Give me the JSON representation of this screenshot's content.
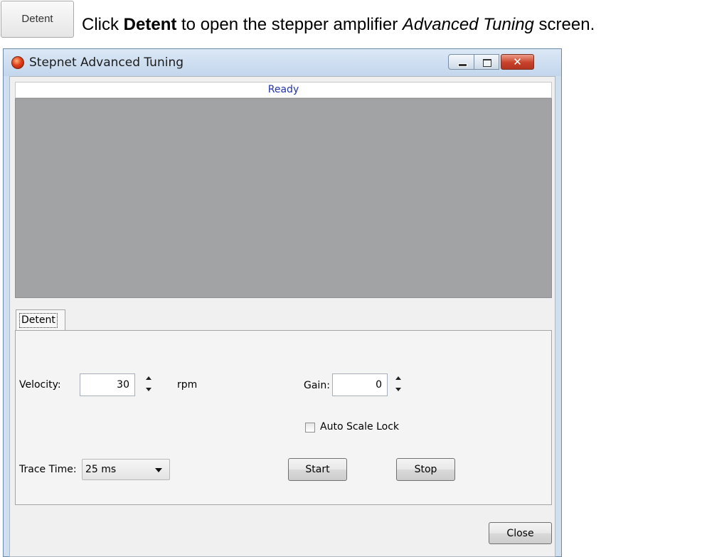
{
  "instruction": {
    "chip_label": "Detent",
    "text_before": "Click ",
    "bold_word": "Detent",
    "text_middle": " to open the stepper amplifier ",
    "italic_phrase": "Advanced Tuning",
    "text_after": " screen."
  },
  "window": {
    "title": "Stepnet Advanced Tuning",
    "close_glyph": "✕"
  },
  "status": "Ready",
  "tabs": [
    {
      "label": "Detent"
    }
  ],
  "controls": {
    "velocity": {
      "label": "Velocity:",
      "value": "30",
      "unit": "rpm"
    },
    "gain": {
      "label": "Gain:",
      "value": "0"
    },
    "auto_scale_lock": {
      "label": "Auto Scale Lock",
      "checked": false
    },
    "trace_time": {
      "label": "Trace Time:",
      "selected": "25 ms"
    },
    "start_label": "Start",
    "stop_label": "Stop",
    "close_label": "Close"
  },
  "colors": {
    "plot_background": "#a1a3a5",
    "status_text": "#2233aa",
    "close_button": "#c8412a"
  },
  "icons": [
    "app-icon",
    "minimize-icon",
    "maximize-icon",
    "close-icon",
    "spin-up-icon",
    "spin-down-icon",
    "dropdown-caret-icon"
  ]
}
